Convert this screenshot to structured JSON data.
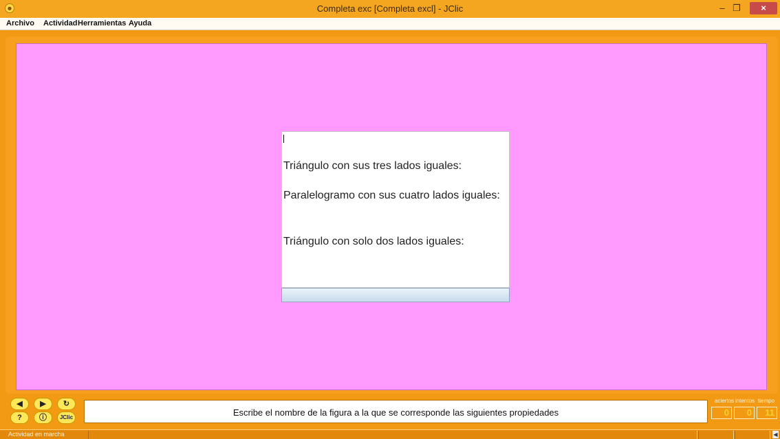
{
  "window": {
    "title": "Completa exc [Completa excl] - JClic",
    "minimize_glyph": "–",
    "maximize_glyph": "❐",
    "close_glyph": "×"
  },
  "menu": {
    "items": [
      {
        "label": "Archivo"
      },
      {
        "label": "Actividad"
      },
      {
        "label": "Herramientas"
      },
      {
        "label": "Ayuda"
      }
    ]
  },
  "activity": {
    "questions": [
      "Triángulo con sus tres lados iguales:",
      "Paralelogramo con sus cuatro lados iguales:",
      "Triángulo con solo dos lados iguales:"
    ]
  },
  "controls": {
    "prev_icon": "arrow-left-icon",
    "next_icon": "arrow-right-icon",
    "restart_icon": "restart-icon",
    "help_icon": "help-icon",
    "info_icon": "info-icon",
    "jclic_label": "JClic"
  },
  "message": {
    "text": "Escribe el nombre de la figura a la que se corresponde las siguientes propiedades"
  },
  "counters": {
    "labels": [
      "aciertos",
      "intentos",
      "tiempo"
    ],
    "aciertos": "0",
    "intentos": "0",
    "tiempo": "11"
  },
  "status": {
    "text": "Actividad en marcha"
  },
  "colors": {
    "frame": "#f39a14",
    "stage": "#ff99ff",
    "counter_digits": "#ffd02a"
  }
}
